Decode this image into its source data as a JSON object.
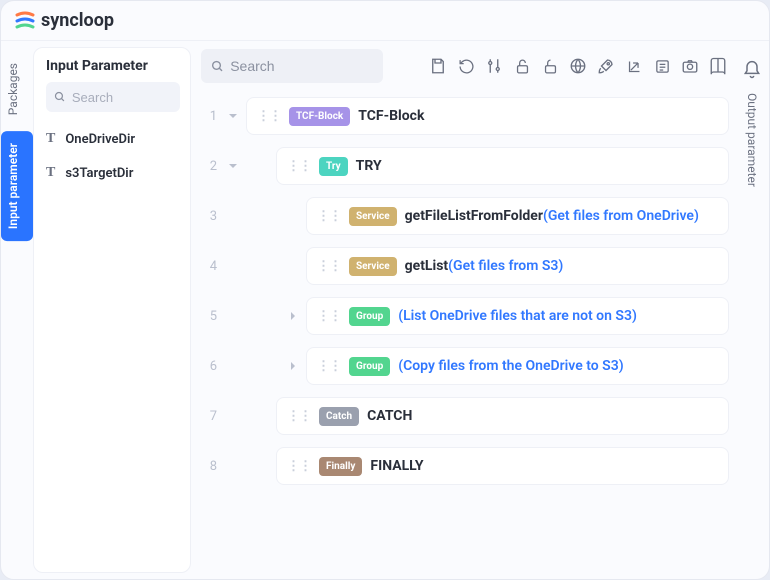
{
  "brand": {
    "name": "syncloop"
  },
  "leftTabs": {
    "packages": "Packages",
    "input": "Input parameter"
  },
  "sidebar": {
    "title": "Input Parameter",
    "searchPlaceholder": "Search",
    "items": [
      {
        "label": "OneDriveDir"
      },
      {
        "label": "s3TargetDir"
      }
    ]
  },
  "mainSearch": {
    "placeholder": "Search"
  },
  "rows": [
    {
      "n": "1",
      "indent": 0,
      "toggle": "down",
      "badge": "TCF-Block",
      "badgeClass": "b-tcf",
      "text": "TCF-Block",
      "hint": ""
    },
    {
      "n": "2",
      "indent": 1,
      "toggle": "down",
      "badge": "Try",
      "badgeClass": "b-try",
      "text": "TRY",
      "hint": ""
    },
    {
      "n": "3",
      "indent": 2,
      "toggle": "",
      "badge": "Service",
      "badgeClass": "b-svc",
      "text": "getFileListFromFolder ",
      "hint": "(Get files from OneDrive)"
    },
    {
      "n": "4",
      "indent": 2,
      "toggle": "",
      "badge": "Service",
      "badgeClass": "b-svc",
      "text": "getList ",
      "hint": "(Get files from S3)"
    },
    {
      "n": "5",
      "indent": 2,
      "toggle": "right",
      "badge": "Group",
      "badgeClass": "b-grp",
      "text": "",
      "hint": "(List OneDrive files that are not on S3)"
    },
    {
      "n": "6",
      "indent": 2,
      "toggle": "right",
      "badge": "Group",
      "badgeClass": "b-grp",
      "text": "",
      "hint": "(Copy files from the OneDrive to S3)"
    },
    {
      "n": "7",
      "indent": 1,
      "toggle": "",
      "badge": "Catch",
      "badgeClass": "b-catch",
      "text": "CATCH",
      "hint": ""
    },
    {
      "n": "8",
      "indent": 1,
      "toggle": "",
      "badge": "Finally",
      "badgeClass": "b-fin",
      "text": "FINALLY",
      "hint": ""
    }
  ],
  "rightTab": "Output parameter"
}
